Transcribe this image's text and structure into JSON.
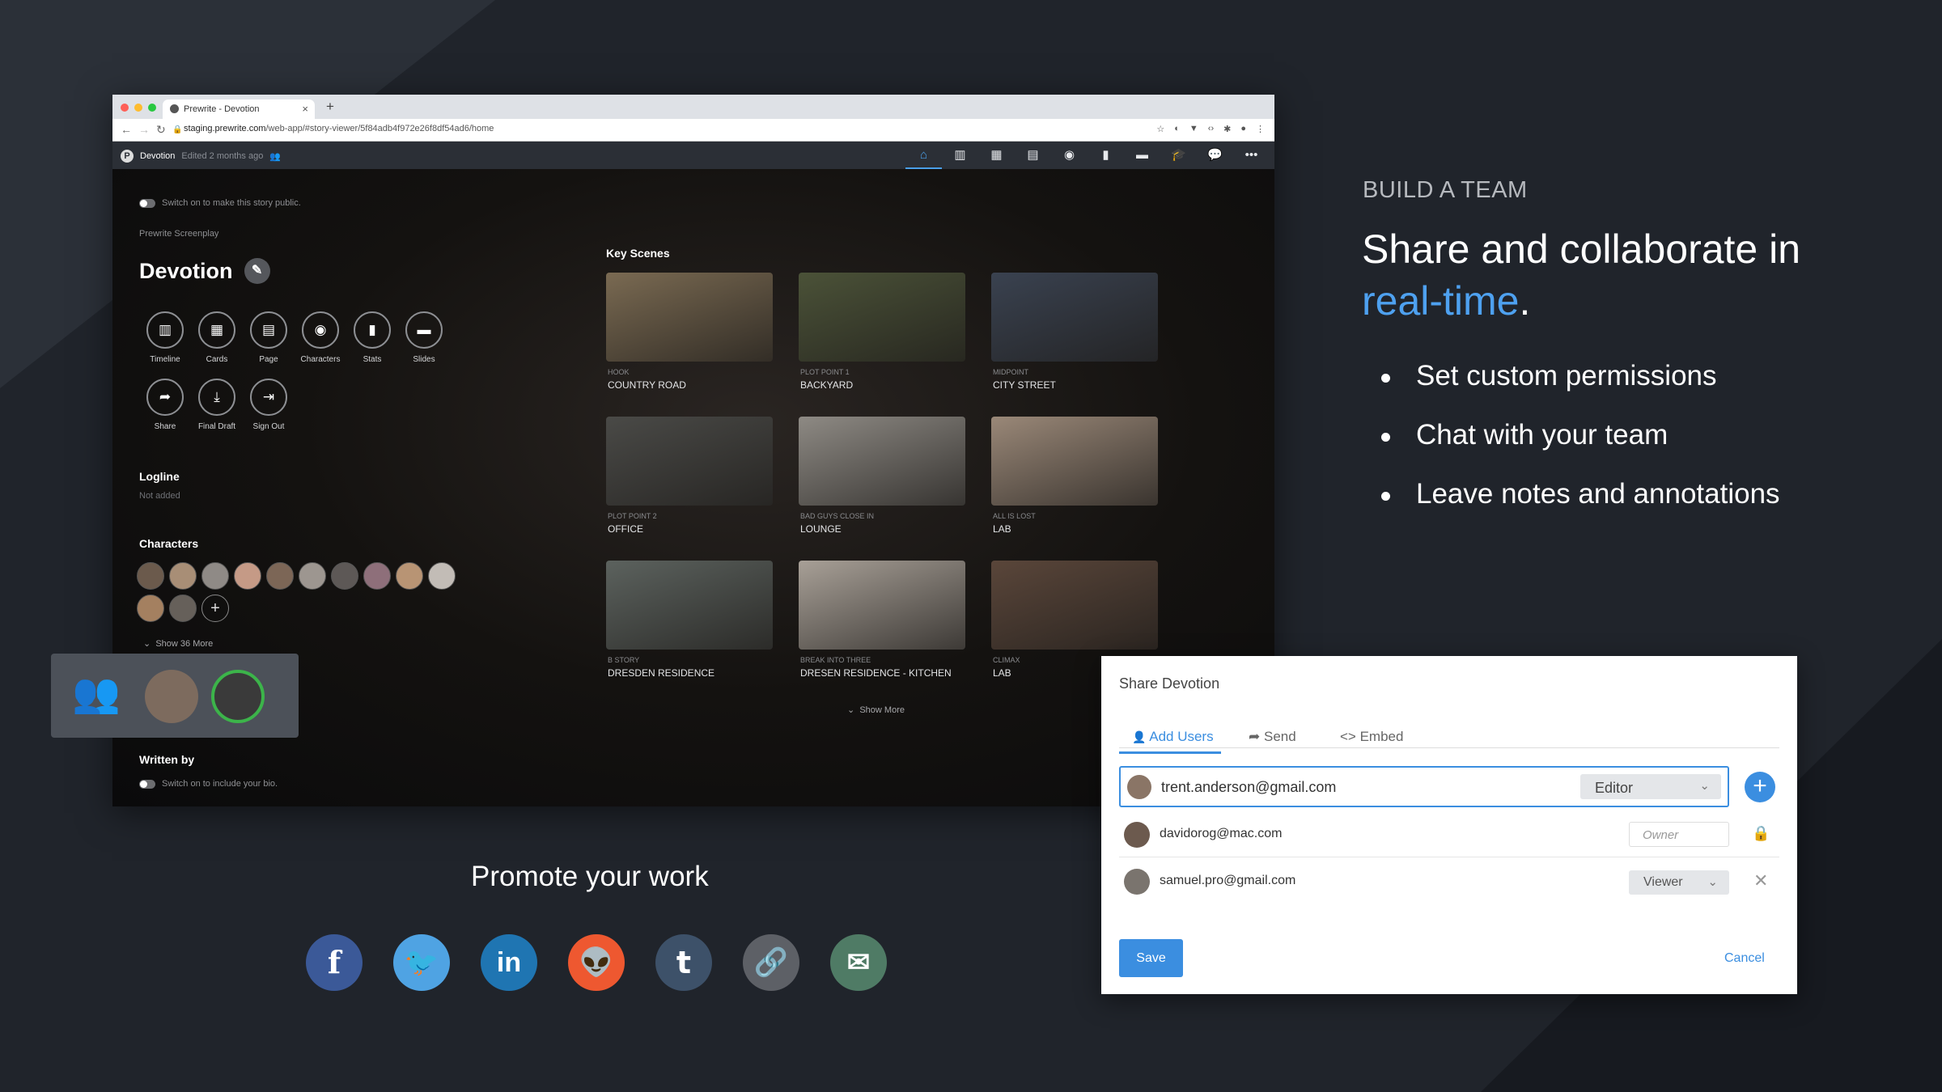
{
  "browser": {
    "tab_title": "Prewrite - Devotion",
    "url_host": "staging.prewrite.com",
    "url_path": "/web-app/#story-viewer/5f84adb4f972e26f8df54ad6/home"
  },
  "appbar": {
    "story": "Devotion",
    "edited": "Edited 2 months ago"
  },
  "sidebar": {
    "public_toggle": "Switch on to make this story public.",
    "screenplay": "Prewrite Screenplay",
    "title": "Devotion",
    "tools": [
      "Timeline",
      "Cards",
      "Page",
      "Characters",
      "Stats",
      "Slides",
      "Share",
      "Final Draft",
      "Sign Out"
    ],
    "logline_heading": "Logline",
    "logline_value": "Not added",
    "characters_heading": "Characters",
    "show_more": "Show 36 More",
    "written_by": "Written by",
    "bio_toggle": "Switch on to include your bio."
  },
  "key_scenes": {
    "heading": "Key Scenes",
    "show_more": "Show More",
    "scenes": [
      {
        "tag": "HOOK",
        "name": "COUNTRY ROAD",
        "color": "#7a6a52"
      },
      {
        "tag": "PLOT POINT 1",
        "name": "BACKYARD",
        "color": "#4b5238"
      },
      {
        "tag": "MIDPOINT",
        "name": "CITY STREET",
        "color": "#3a4250"
      },
      {
        "tag": "PLOT POINT 2",
        "name": "OFFICE",
        "color": "#4a4a47"
      },
      {
        "tag": "BAD GUYS CLOSE IN",
        "name": "LOUNGE",
        "color": "#8e8a84"
      },
      {
        "tag": "ALL IS LOST",
        "name": "LAB",
        "color": "#9a8878"
      },
      {
        "tag": "B STORY",
        "name": "DRESDEN RESIDENCE",
        "color": "#5c625e"
      },
      {
        "tag": "BREAK INTO THREE",
        "name": "DRESEN RESIDENCE - KITCHEN",
        "color": "#a8a097"
      },
      {
        "tag": "CLIMAX",
        "name": "LAB",
        "color": "#5a463a"
      }
    ]
  },
  "promo": {
    "kicker": "BUILD A TEAM",
    "headline_pre": "Share and collaborate in ",
    "headline_highlight": "real-time",
    "headline_post": ".",
    "bullets": [
      "Set custom permissions",
      "Chat with your team",
      "Leave notes and annotations"
    ],
    "promote": "Promote your work"
  },
  "share_dialog": {
    "title": "Share Devotion",
    "tabs": [
      "Add Users",
      "Send",
      "Embed"
    ],
    "email": "trent.anderson@gmail.com",
    "role": "Editor",
    "users": [
      {
        "email": "davidorog@mac.com",
        "role": "Owner"
      },
      {
        "email": "samuel.pro@gmail.com",
        "role": "Viewer"
      }
    ],
    "save": "Save",
    "cancel": "Cancel"
  },
  "socials": [
    "facebook",
    "twitter",
    "linkedin",
    "reddit",
    "tumblr",
    "link",
    "email"
  ],
  "colors": {
    "accent": "#3b8ee0",
    "highlight": "#4ea1f0",
    "background": "#20242b"
  }
}
